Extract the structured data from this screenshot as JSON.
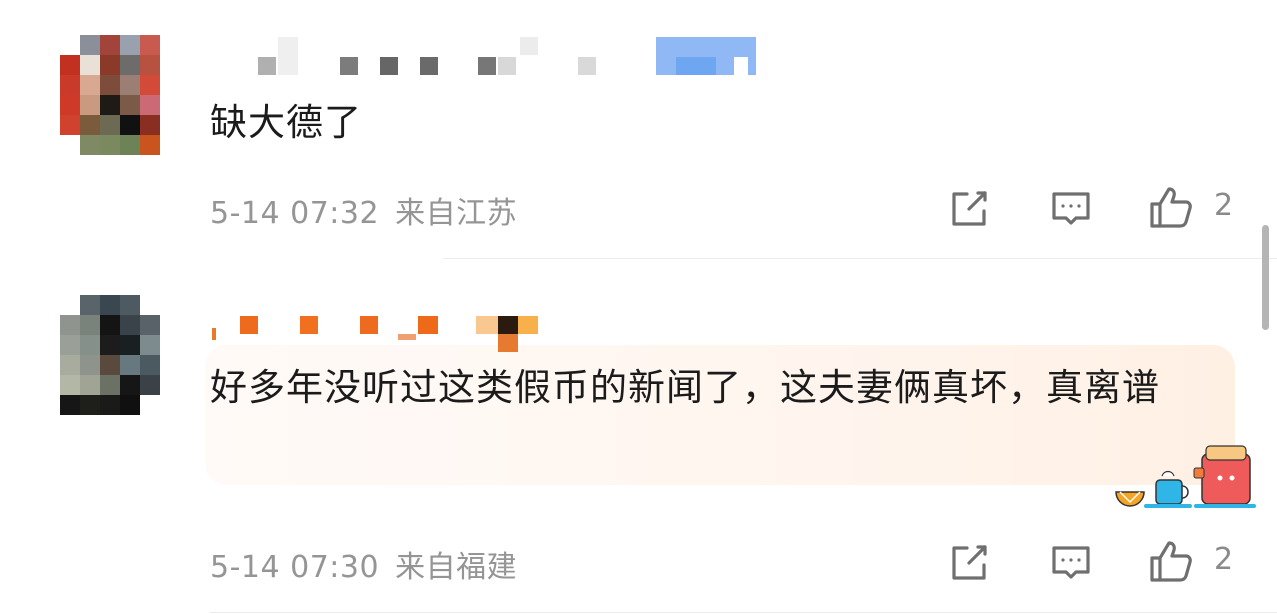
{
  "comments": [
    {
      "text": "缺大德了",
      "time": "5-14 07:32",
      "location": "来自江苏",
      "likes": "2",
      "icons": {
        "share": "share-icon",
        "comment": "comment-icon",
        "like": "thumbs-up-icon"
      }
    },
    {
      "text": "好多年没听过这类假币的新闻了，这夫妻俩真坏，真离谱",
      "time": "5-14 07:30",
      "location": "来自福建",
      "likes": "2",
      "icons": {
        "share": "share-icon",
        "comment": "comment-icon",
        "like": "thumbs-up-icon"
      }
    }
  ],
  "colors": {
    "meta": "#959595",
    "text": "#1b1b1b",
    "card": "#fff5ee",
    "icon": "#6f6f6f"
  }
}
